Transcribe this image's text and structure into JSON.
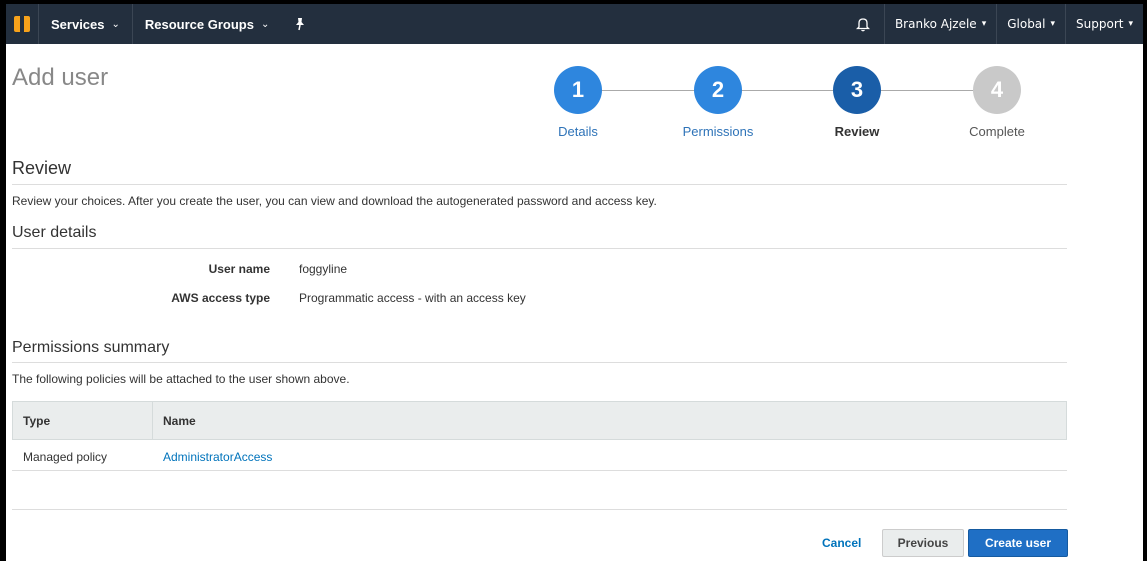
{
  "nav": {
    "services": "Services",
    "resource_groups": "Resource Groups",
    "user": "Branko Ajzele",
    "region": "Global",
    "support": "Support"
  },
  "page_title": "Add user",
  "steps": [
    {
      "num": "1",
      "label": "Details",
      "state": "done"
    },
    {
      "num": "2",
      "label": "Permissions",
      "state": "done"
    },
    {
      "num": "3",
      "label": "Review",
      "state": "active"
    },
    {
      "num": "4",
      "label": "Complete",
      "state": "todo"
    }
  ],
  "review": {
    "heading": "Review",
    "description": "Review your choices. After you create the user, you can view and download the autogenerated password and access key."
  },
  "user_details": {
    "heading": "User details",
    "rows": [
      {
        "label": "User name",
        "value": "foggyline"
      },
      {
        "label": "AWS access type",
        "value": "Programmatic access - with an access key"
      }
    ]
  },
  "permissions": {
    "heading": "Permissions summary",
    "description": "The following policies will be attached to the user shown above.",
    "columns": [
      "Type",
      "Name"
    ],
    "rows": [
      {
        "type": "Managed policy",
        "name": "AdministratorAccess"
      }
    ]
  },
  "buttons": {
    "cancel": "Cancel",
    "previous": "Previous",
    "create": "Create user"
  }
}
